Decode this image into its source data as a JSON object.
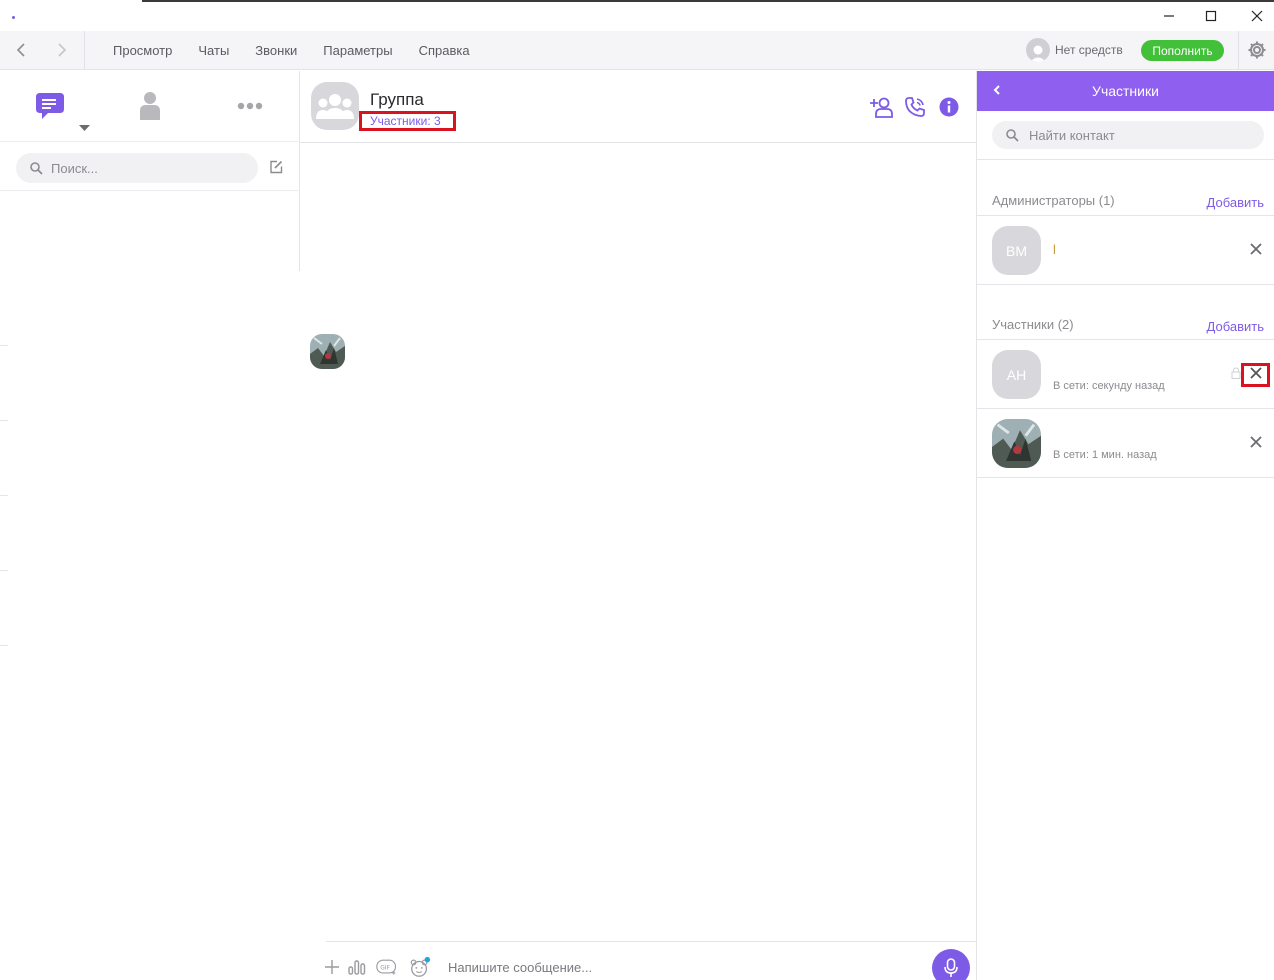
{
  "menu": {
    "items": [
      "Просмотр",
      "Чаты",
      "Звонки",
      "Параметры",
      "Справка"
    ],
    "balance_text": "Нет средств",
    "topup_label": "Пополнить"
  },
  "sidebar": {
    "search_placeholder": "Поиск..."
  },
  "chat": {
    "title": "Группа",
    "members_count": "Участники: 3",
    "composer_placeholder": "Напишите сообщение..."
  },
  "panel": {
    "title": "Участники",
    "search_placeholder": "Найти контакт",
    "admins_label": "Администраторы (1)",
    "members_label": "Участники (2)",
    "add_label": "Добавить",
    "admins": [
      {
        "initials": "ВМ",
        "name": "l",
        "status": ""
      }
    ],
    "members": [
      {
        "initials": "АН",
        "name": "",
        "status": "В сети: секунду назад"
      },
      {
        "initials": "",
        "name": "",
        "status": "В сети: 1 мин. назад"
      }
    ]
  },
  "colors": {
    "accent": "#7d5be6",
    "panel_header": "#8f5ff0",
    "topup": "#43c03a",
    "highlight": "#d9141f"
  }
}
